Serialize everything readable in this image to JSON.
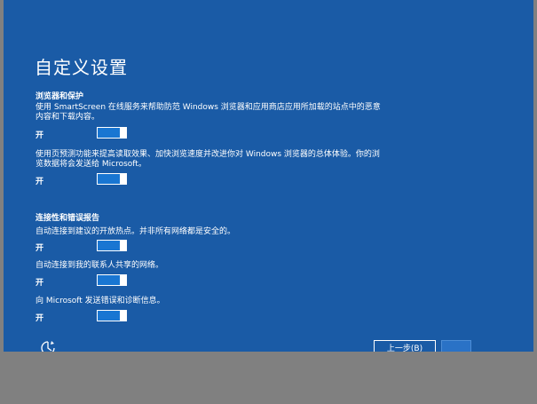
{
  "page": {
    "title": "自定义设置"
  },
  "browser_section": {
    "heading": "浏览器和保护",
    "items": [
      {
        "description": "使用 SmartScreen 在线服务来帮助防范 Windows 浏览器和应用商店应用所加载的站点中的恶意内容和下载内容。",
        "state_label": "开",
        "on": true
      },
      {
        "description": "使用页预测功能来提高读取效果、加快浏览速度并改进你对 Windows 浏览器的总体体验。你的浏览数据将会发送给 Microsoft。",
        "state_label": "开",
        "on": true
      }
    ]
  },
  "connectivity_section": {
    "heading": "连接性和错误报告",
    "items": [
      {
        "description": "自动连接到建议的开放热点。并非所有网络都是安全的。",
        "state_label": "开",
        "on": true
      },
      {
        "description": "自动连接到我的联系人共享的网络。",
        "state_label": "开",
        "on": true
      },
      {
        "description": "向 Microsoft 发送错误和诊断信息。",
        "state_label": "开",
        "on": true
      }
    ]
  },
  "footer": {
    "cortana_icon": "ease-of-access-icon",
    "back_label": "上一步(B)",
    "next_label": ""
  },
  "colors": {
    "background": "#1a5ba6",
    "toggle_on": "#1976d2",
    "footer_gray": "#808080"
  }
}
